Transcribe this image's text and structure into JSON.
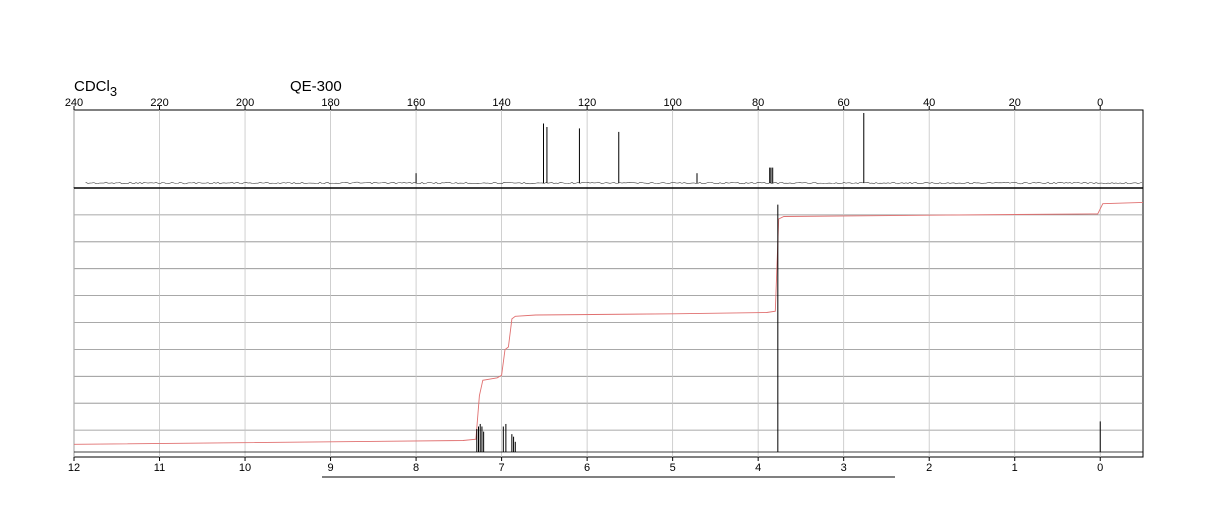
{
  "header": {
    "solvent_main": "CDCl",
    "solvent_sub": "3",
    "instrument": "QE-300"
  },
  "chart_data": [
    {
      "type": "line",
      "name": "13C NMR spectrum",
      "xlim": [
        240,
        -10
      ],
      "x_reversed": true,
      "xticks": [
        240,
        220,
        200,
        180,
        160,
        140,
        120,
        100,
        80,
        60,
        40,
        20,
        0
      ],
      "grid": true,
      "peaks": [
        {
          "x": 160.0,
          "y": 0.14
        },
        {
          "x": 130.2,
          "y": 0.85
        },
        {
          "x": 129.4,
          "y": 0.8
        },
        {
          "x": 121.8,
          "y": 0.78
        },
        {
          "x": 112.6,
          "y": 0.73
        },
        {
          "x": 94.3,
          "y": 0.14
        },
        {
          "x": 77.3,
          "y": 0.22
        },
        {
          "x": 77.0,
          "y": 0.22
        },
        {
          "x": 76.6,
          "y": 0.22
        },
        {
          "x": 55.3,
          "y": 1.0
        }
      ]
    },
    {
      "type": "line",
      "name": "1H NMR spectrum",
      "xlim": [
        12,
        -0.5
      ],
      "x_reversed": true,
      "xticks": [
        12,
        11,
        10,
        9,
        8,
        7,
        6,
        5,
        4,
        3,
        2,
        1,
        0
      ],
      "grid": true,
      "peaks": [
        {
          "x": 7.29,
          "y": 0.09
        },
        {
          "x": 7.27,
          "y": 0.1
        },
        {
          "x": 7.25,
          "y": 0.11
        },
        {
          "x": 7.23,
          "y": 0.1
        },
        {
          "x": 7.21,
          "y": 0.08
        },
        {
          "x": 6.98,
          "y": 0.1
        },
        {
          "x": 6.95,
          "y": 0.11
        },
        {
          "x": 6.88,
          "y": 0.07
        },
        {
          "x": 6.86,
          "y": 0.06
        },
        {
          "x": 6.84,
          "y": 0.04
        },
        {
          "x": 3.77,
          "y": 0.97
        },
        {
          "x": 0.0,
          "y": 0.12
        }
      ],
      "integral": {
        "color": "#e07070",
        "points": [
          [
            12.0,
            0.03
          ],
          [
            7.45,
            0.045
          ],
          [
            7.3,
            0.05
          ],
          [
            7.26,
            0.22
          ],
          [
            7.22,
            0.28
          ],
          [
            7.05,
            0.29
          ],
          [
            7.0,
            0.3
          ],
          [
            6.96,
            0.4
          ],
          [
            6.92,
            0.41
          ],
          [
            6.88,
            0.52
          ],
          [
            6.84,
            0.53
          ],
          [
            6.6,
            0.535
          ],
          [
            5.0,
            0.54
          ],
          [
            3.9,
            0.545
          ],
          [
            3.8,
            0.55
          ],
          [
            3.76,
            0.91
          ],
          [
            3.7,
            0.92
          ],
          [
            2.0,
            0.925
          ],
          [
            0.1,
            0.93
          ],
          [
            0.03,
            0.93
          ],
          [
            -0.03,
            0.97
          ],
          [
            -0.5,
            0.975
          ]
        ]
      }
    }
  ]
}
